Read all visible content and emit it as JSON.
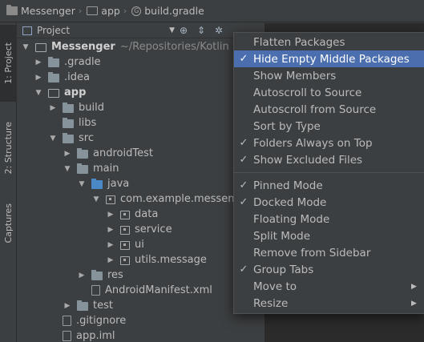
{
  "breadcrumb": {
    "items": [
      {
        "label": "Messenger"
      },
      {
        "label": "app"
      },
      {
        "label": "build.gradle"
      }
    ]
  },
  "tool_strip": {
    "project_tab": "1: Project",
    "structure_tab": "2: Structure",
    "captures_tab": "Captures"
  },
  "project_panel": {
    "view_selector": "Project",
    "tree": [
      {
        "label": "Messenger",
        "path": "~/Repositories/Kotlin pro"
      },
      {
        "label": ".gradle"
      },
      {
        "label": ".idea"
      },
      {
        "label": "app"
      },
      {
        "label": "build"
      },
      {
        "label": "libs"
      },
      {
        "label": "src"
      },
      {
        "label": "androidTest"
      },
      {
        "label": "main"
      },
      {
        "label": "java"
      },
      {
        "label": "com.example.messen"
      },
      {
        "label": "data"
      },
      {
        "label": "service"
      },
      {
        "label": "ui"
      },
      {
        "label": "utils.message"
      },
      {
        "label": "res"
      },
      {
        "label": "AndroidManifest.xml"
      },
      {
        "label": "test"
      },
      {
        "label": ".gitignore"
      },
      {
        "label": "app.iml"
      }
    ]
  },
  "menu": {
    "items": [
      {
        "label": "Flatten Packages",
        "checked": false
      },
      {
        "label": "Hide Empty Middle Packages",
        "checked": true,
        "selected": true
      },
      {
        "label": "Show Members",
        "checked": false
      },
      {
        "label": "Autoscroll to Source",
        "checked": false
      },
      {
        "label": "Autoscroll from Source",
        "checked": false
      },
      {
        "label": "Sort by Type",
        "checked": false
      },
      {
        "label": "Folders Always on Top",
        "checked": true
      },
      {
        "label": "Show Excluded Files",
        "checked": true
      },
      {
        "label": "Pinned Mode",
        "checked": true
      },
      {
        "label": "Docked Mode",
        "checked": true
      },
      {
        "label": "Floating Mode",
        "checked": false
      },
      {
        "label": "Split Mode",
        "checked": false
      },
      {
        "label": "Remove from Sidebar",
        "checked": false
      },
      {
        "label": "Group Tabs",
        "checked": true
      },
      {
        "label": "Move to",
        "checked": false,
        "submenu": true
      },
      {
        "label": "Resize",
        "checked": false,
        "submenu": true
      }
    ],
    "check_glyph": "✓",
    "submenu_glyph": "▶"
  },
  "colors": {
    "panel_bg": "#3c3f41",
    "selection": "#4b6eaf",
    "source_folder": "#4a88c7"
  }
}
